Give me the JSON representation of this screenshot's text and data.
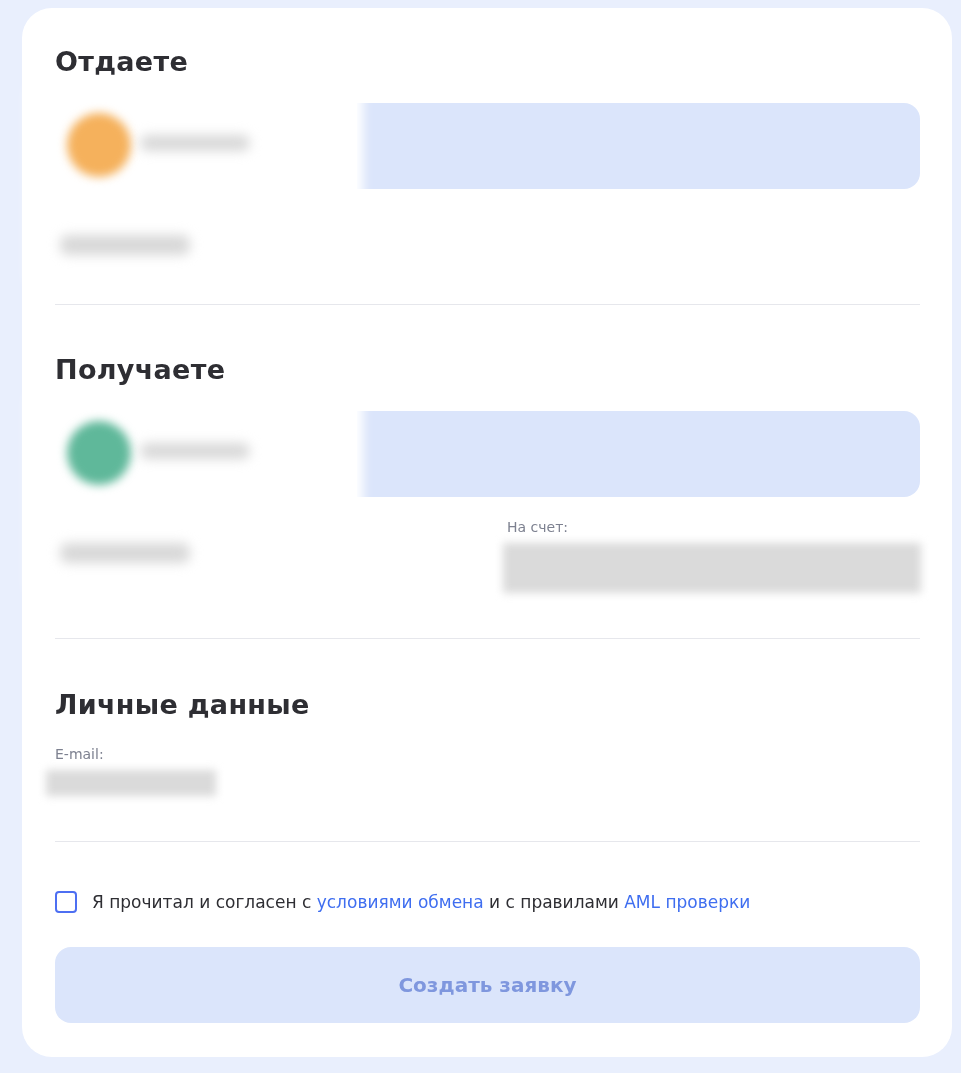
{
  "send": {
    "title": "Отдаете",
    "coin": {
      "color": "#f5b15c"
    }
  },
  "receive": {
    "title": "Получаете",
    "coin": {
      "color": "#5fb89a"
    },
    "account_label": "На счет:"
  },
  "personal": {
    "title": "Личные данные",
    "email_label": "E-mail:"
  },
  "agreement": {
    "checked": false,
    "text_1": "Я прочитал и согласен с",
    "link_1": "условиями обмена",
    "text_2": "и с правилами",
    "link_2": "AML проверки"
  },
  "submit": {
    "label": "Создать заявку",
    "disabled": true
  }
}
